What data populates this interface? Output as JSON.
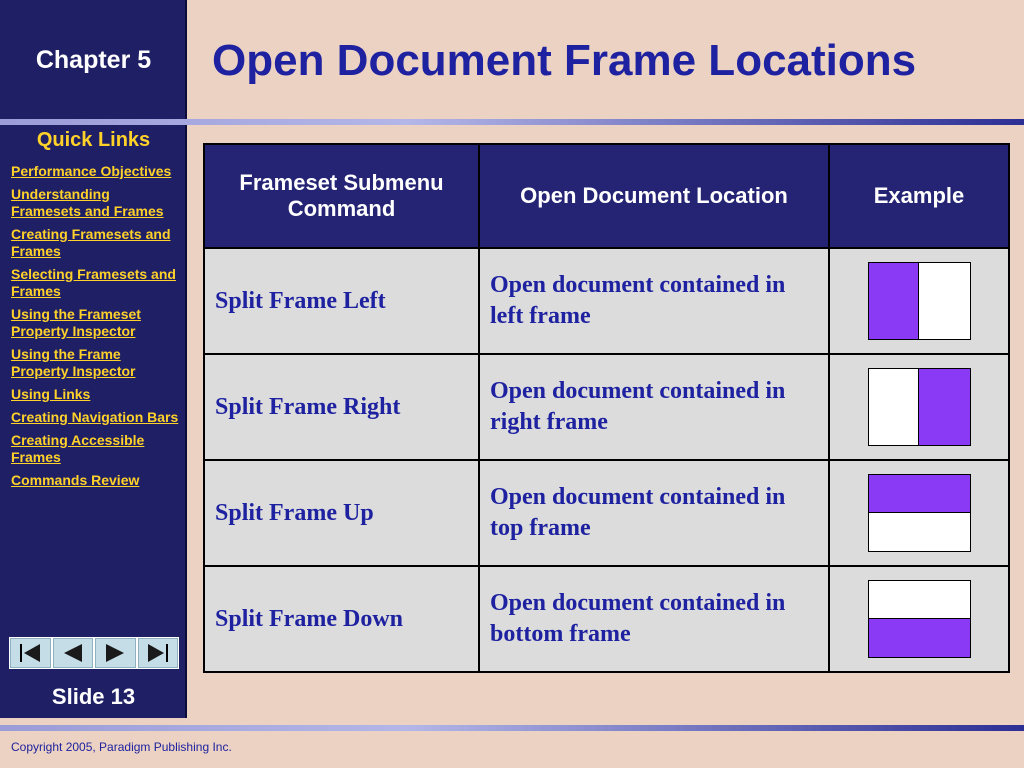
{
  "sidebar": {
    "chapter": "Chapter 5",
    "quick_links_title": "Quick Links",
    "links": [
      "Performance Objectives",
      "Understanding Framesets and Frames",
      "Creating Framesets and Frames",
      "Selecting Framesets and Frames",
      "Using the Frameset Property Inspector",
      "Using the Frame Property Inspector",
      "Using Links",
      "Creating Navigation Bars",
      "Creating Accessible Frames",
      "Commands Review"
    ],
    "nav_icons": [
      "first-slide-icon",
      "previous-slide-icon",
      "next-slide-icon",
      "last-slide-icon"
    ],
    "slide_label": "Slide 13"
  },
  "title": "Open Document Frame Locations",
  "table": {
    "headers": [
      "Frameset Submenu Command",
      "Open Document Location",
      "Example"
    ],
    "rows": [
      {
        "command": "Split Frame Left",
        "location": "Open document contained in left frame",
        "example": "left"
      },
      {
        "command": "Split Frame Right",
        "location": "Open document contained in right frame",
        "example": "right"
      },
      {
        "command": "Split Frame Up",
        "location": "Open document contained in top frame",
        "example": "top"
      },
      {
        "command": "Split Frame Down",
        "location": "Open document contained in bottom frame",
        "example": "bottom"
      }
    ]
  },
  "footer": {
    "copyright": "Copyright 2005, Paradigm Publishing Inc."
  },
  "colors": {
    "sidebar_bg": "#1f1f66",
    "link": "#ffd22a",
    "title": "#1e22a0",
    "header_bg": "#252474",
    "highlight": "#8a3af5",
    "page_bg": "#ecd2c2"
  }
}
